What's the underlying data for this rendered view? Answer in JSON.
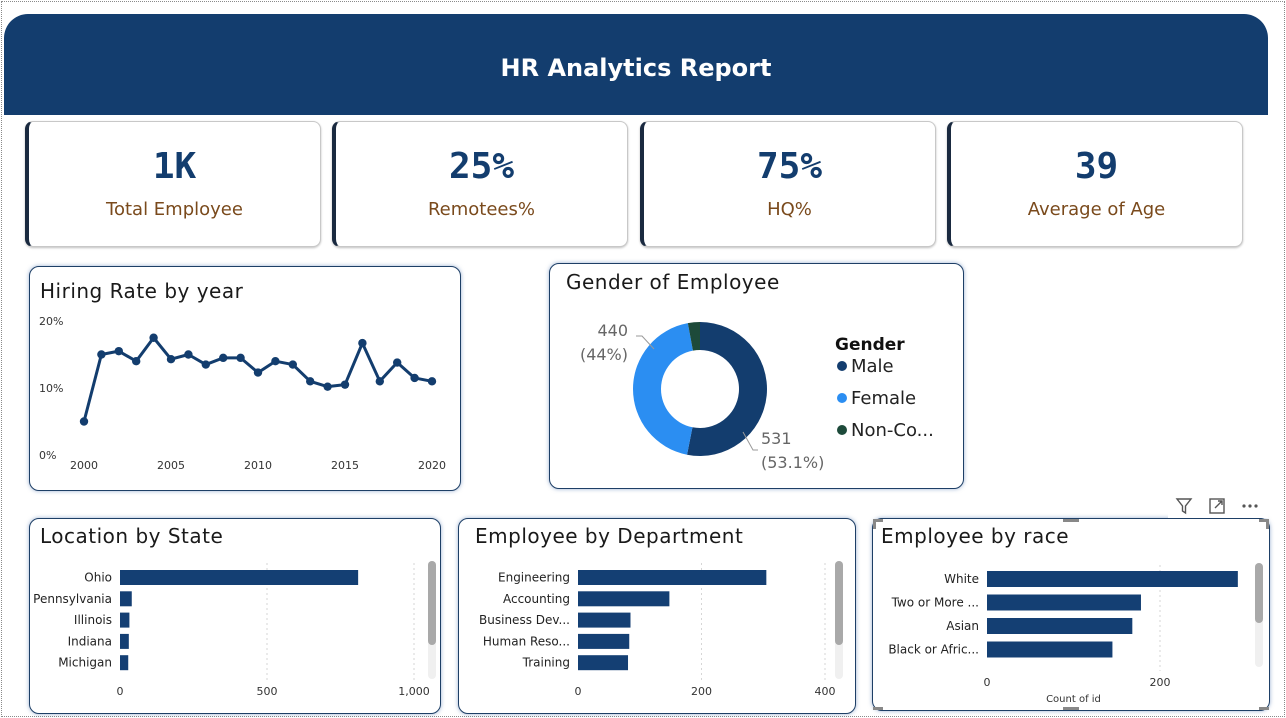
{
  "header": {
    "title": "HR Analytics Report"
  },
  "kpis": [
    {
      "value": "1K",
      "label": "Total Employee"
    },
    {
      "value": "25%",
      "label": "Remotees%"
    },
    {
      "value": "75%",
      "label": "HQ%"
    },
    {
      "value": "39",
      "label": "Average of Age"
    }
  ],
  "hiring": {
    "title": "Hiring Rate by year"
  },
  "gender": {
    "title": "Gender of Employee"
  },
  "location": {
    "title": "Location by State"
  },
  "department": {
    "title": "Employee by Department"
  },
  "race": {
    "title": "Employee by race"
  },
  "toolbar": {
    "filter_icon": "filter-icon",
    "focus_icon": "focus-mode-icon",
    "more_icon": "more-options-icon"
  },
  "colors": {
    "navy": "#133d6e",
    "bar": "#143f73",
    "female": "#2b8ef2",
    "non_conforming": "#1d4a3a",
    "kpi_label": "#7a4a1c"
  },
  "chart_data": [
    {
      "type": "line",
      "title": "Hiring Rate by year",
      "x": [
        2000,
        2001,
        2002,
        2003,
        2004,
        2005,
        2006,
        2007,
        2008,
        2009,
        2010,
        2011,
        2012,
        2013,
        2014,
        2015,
        2016,
        2017,
        2018,
        2019,
        2020
      ],
      "y": [
        5,
        15,
        15.5,
        14,
        17.5,
        14.3,
        15,
        13.5,
        14.5,
        14.5,
        12.3,
        14,
        13.5,
        11,
        10.2,
        10.5,
        16.7,
        11,
        13.8,
        11.5,
        11
      ],
      "xticks": [
        "2000",
        "2005",
        "2010",
        "2015",
        "2020"
      ],
      "yticks": [
        "0%",
        "10%",
        "20%"
      ],
      "ylim": [
        0,
        20
      ]
    },
    {
      "type": "pie",
      "title": "Gender of Employee",
      "legend_title": "Gender",
      "categories": [
        "Male",
        "Female",
        "Non-Co..."
      ],
      "values": [
        531,
        440,
        29
      ],
      "labels": [
        {
          "value": "531",
          "pct": "(53.1%)"
        },
        {
          "value": "440",
          "pct": "(44%)"
        }
      ]
    },
    {
      "type": "bar",
      "title": "Location by State",
      "categories": [
        "Ohio",
        "Pennsylvania",
        "Illinois",
        "Indiana",
        "Michigan"
      ],
      "values": [
        810,
        40,
        32,
        30,
        28
      ],
      "xticks": [
        "0",
        "500",
        "1,000"
      ],
      "xlim": [
        0,
        1000
      ]
    },
    {
      "type": "bar",
      "title": "Employee by Department",
      "categories": [
        "Engineering",
        "Accounting",
        "Business Dev...",
        "Human Reso...",
        "Training"
      ],
      "values": [
        305,
        148,
        85,
        83,
        81
      ],
      "xticks": [
        "0",
        "200",
        "400"
      ],
      "xlim": [
        0,
        400
      ]
    },
    {
      "type": "bar",
      "title": "Employee by race",
      "categories": [
        "White",
        "Two or More ...",
        "Asian",
        "Black or Afric..."
      ],
      "values": [
        290,
        178,
        168,
        145
      ],
      "xticks": [
        "0",
        "200"
      ],
      "xlim": [
        0,
        200
      ],
      "xlabel": "Count of id"
    }
  ]
}
